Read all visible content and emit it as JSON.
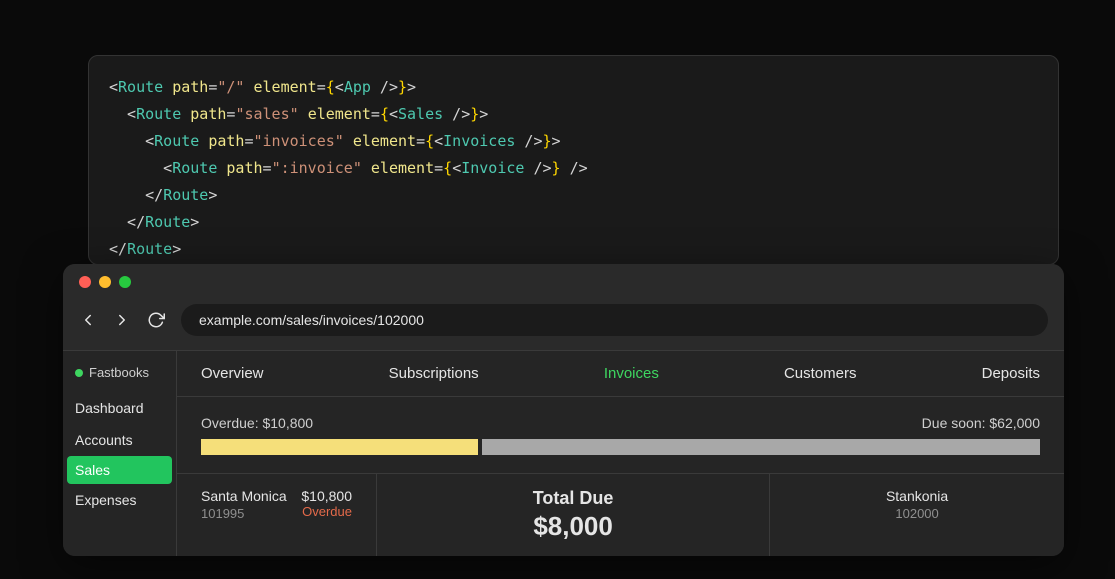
{
  "code": {
    "lines": [
      [
        {
          "t": "<",
          "c": "punc"
        },
        {
          "t": "Route",
          "c": "tag"
        },
        {
          "t": " ",
          "c": "punc"
        },
        {
          "t": "path",
          "c": "attr"
        },
        {
          "t": "=",
          "c": "punc"
        },
        {
          "t": "\"/\"",
          "c": "str"
        },
        {
          "t": " ",
          "c": "punc"
        },
        {
          "t": "element",
          "c": "attr"
        },
        {
          "t": "=",
          "c": "punc"
        },
        {
          "t": "{",
          "c": "brace"
        },
        {
          "t": "<",
          "c": "punc"
        },
        {
          "t": "App",
          "c": "tag"
        },
        {
          "t": " />",
          "c": "punc"
        },
        {
          "t": "}",
          "c": "brace"
        },
        {
          "t": ">",
          "c": "punc"
        }
      ],
      [
        {
          "t": "  <",
          "c": "punc"
        },
        {
          "t": "Route",
          "c": "tag"
        },
        {
          "t": " ",
          "c": "punc"
        },
        {
          "t": "path",
          "c": "attr"
        },
        {
          "t": "=",
          "c": "punc"
        },
        {
          "t": "\"sales\"",
          "c": "str"
        },
        {
          "t": " ",
          "c": "punc"
        },
        {
          "t": "element",
          "c": "attr"
        },
        {
          "t": "=",
          "c": "punc"
        },
        {
          "t": "{",
          "c": "brace"
        },
        {
          "t": "<",
          "c": "punc"
        },
        {
          "t": "Sales",
          "c": "tag"
        },
        {
          "t": " />",
          "c": "punc"
        },
        {
          "t": "}",
          "c": "brace"
        },
        {
          "t": ">",
          "c": "punc"
        }
      ],
      [
        {
          "t": "    <",
          "c": "punc"
        },
        {
          "t": "Route",
          "c": "tag"
        },
        {
          "t": " ",
          "c": "punc"
        },
        {
          "t": "path",
          "c": "attr"
        },
        {
          "t": "=",
          "c": "punc"
        },
        {
          "t": "\"invoices\"",
          "c": "str"
        },
        {
          "t": " ",
          "c": "punc"
        },
        {
          "t": "element",
          "c": "attr"
        },
        {
          "t": "=",
          "c": "punc"
        },
        {
          "t": "{",
          "c": "brace"
        },
        {
          "t": "<",
          "c": "punc"
        },
        {
          "t": "Invoices",
          "c": "tag"
        },
        {
          "t": " />",
          "c": "punc"
        },
        {
          "t": "}",
          "c": "brace"
        },
        {
          "t": ">",
          "c": "punc"
        }
      ],
      [
        {
          "t": "      <",
          "c": "punc"
        },
        {
          "t": "Route",
          "c": "tag"
        },
        {
          "t": " ",
          "c": "punc"
        },
        {
          "t": "path",
          "c": "attr"
        },
        {
          "t": "=",
          "c": "punc"
        },
        {
          "t": "\":invoice\"",
          "c": "str"
        },
        {
          "t": " ",
          "c": "punc"
        },
        {
          "t": "element",
          "c": "attr"
        },
        {
          "t": "=",
          "c": "punc"
        },
        {
          "t": "{",
          "c": "brace"
        },
        {
          "t": "<",
          "c": "punc"
        },
        {
          "t": "Invoice",
          "c": "tag"
        },
        {
          "t": " />",
          "c": "punc"
        },
        {
          "t": "}",
          "c": "brace"
        },
        {
          "t": " />",
          "c": "punc"
        }
      ],
      [
        {
          "t": "    </",
          "c": "punc"
        },
        {
          "t": "Route",
          "c": "tag"
        },
        {
          "t": ">",
          "c": "punc"
        }
      ],
      [
        {
          "t": "  </",
          "c": "punc"
        },
        {
          "t": "Route",
          "c": "tag"
        },
        {
          "t": ">",
          "c": "punc"
        }
      ],
      [
        {
          "t": "</",
          "c": "punc"
        },
        {
          "t": "Route",
          "c": "tag"
        },
        {
          "t": ">",
          "c": "punc"
        }
      ]
    ]
  },
  "browser": {
    "url": "example.com/sales/invoices/102000"
  },
  "brand": {
    "name": "Fastbooks"
  },
  "sidebar": {
    "items": [
      {
        "label": "Dashboard",
        "active": false
      },
      {
        "label": "Accounts",
        "active": false
      },
      {
        "label": "Sales",
        "active": true
      },
      {
        "label": "Expenses",
        "active": false
      }
    ]
  },
  "tabs": [
    {
      "label": "Overview",
      "active": false
    },
    {
      "label": "Subscriptions",
      "active": false
    },
    {
      "label": "Invoices",
      "active": true
    },
    {
      "label": "Customers",
      "active": false
    },
    {
      "label": "Deposits",
      "active": false
    }
  ],
  "summary": {
    "overdue_label": "Overdue: $10,800",
    "duesoon_label": "Due soon: $62,000"
  },
  "leftInvoice": {
    "name": "Santa Monica",
    "id": "101995",
    "amount": "$10,800",
    "status": "Overdue"
  },
  "centerInvoice": {
    "label": "Total Due",
    "amount": "$8,000"
  },
  "rightInvoice": {
    "name": "Stankonia",
    "id": "102000"
  }
}
